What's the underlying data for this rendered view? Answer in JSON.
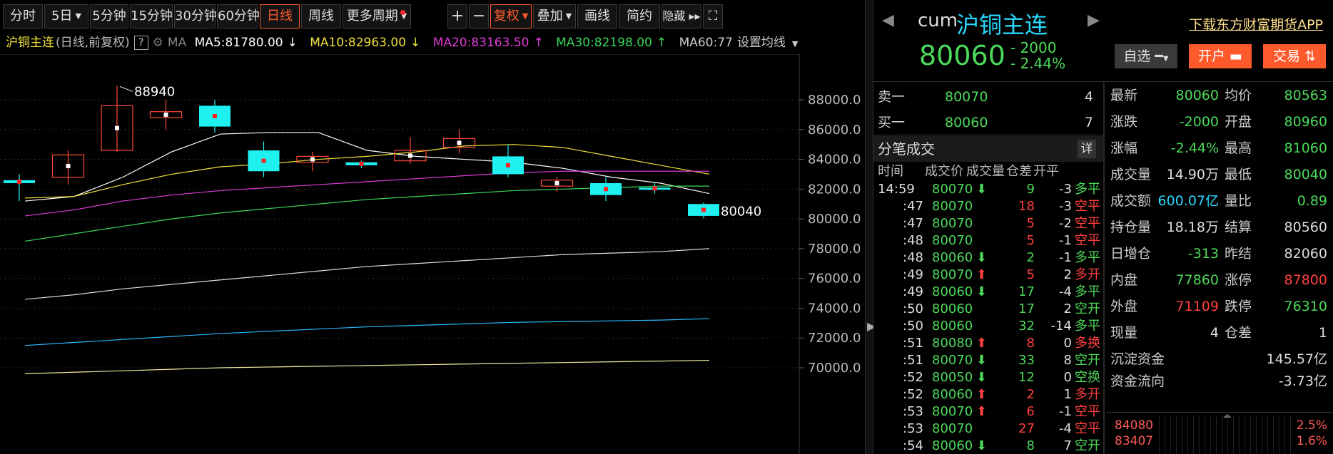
{
  "toolbar": {
    "items": [
      "分时",
      "5日",
      "5分钟",
      "15分钟",
      "30分钟",
      "60分钟",
      "日线",
      "周线",
      "更多周期"
    ],
    "plus": "+",
    "minus": "−",
    "fuquan": "复权",
    "diejia": "叠加",
    "huaxian": "画线",
    "jiancao": "简约",
    "yincang": "隐藏 ▸▸",
    "expand": "⛶"
  },
  "ma_line": {
    "symbol": "沪铜主连",
    "mode": "(日线,前复权)",
    "help": "?",
    "ma_label": "MA",
    "ma5": "MA5:81780.00",
    "ma10": "MA10:82963.00",
    "ma20": "MA20:83163.50",
    "ma30": "MA30:82198.00",
    "ma60": "MA60:77",
    "set": "设置均线",
    "arrow_down": "↓",
    "arrow_up": "↑",
    "colors": {
      "ma5": "#ffffff",
      "ma10": "#f2e03a",
      "ma20": "#e03ad8",
      "ma30": "#3ad85a",
      "ma60": "#cccccc"
    }
  },
  "chart_data": {
    "type": "candlestick",
    "yaxis_ticks": [
      "88000.0",
      "86000.0",
      "84000.0",
      "82000.0",
      "80000.0",
      "78000.0",
      "76000.0",
      "74000.0",
      "72000.0",
      "70000.0"
    ],
    "ylim": [
      69000,
      90000
    ],
    "high_label": "88940",
    "low_label": "80040",
    "candles": [
      {
        "o": 82600,
        "c": 82400,
        "h": 83000,
        "l": 81200
      },
      {
        "o": 82800,
        "c": 84300,
        "h": 84600,
        "l": 82300
      },
      {
        "o": 84600,
        "c": 87600,
        "h": 88940,
        "l": 84500
      },
      {
        "o": 86800,
        "c": 87200,
        "h": 88000,
        "l": 86000
      },
      {
        "o": 87600,
        "c": 86200,
        "h": 88000,
        "l": 85800
      },
      {
        "o": 84600,
        "c": 83200,
        "h": 85200,
        "l": 82800
      },
      {
        "o": 83800,
        "c": 84200,
        "h": 84500,
        "l": 83200
      },
      {
        "o": 83800,
        "c": 83600,
        "h": 83900,
        "l": 83400
      },
      {
        "o": 83900,
        "c": 84600,
        "h": 85500,
        "l": 83700
      },
      {
        "o": 84800,
        "c": 85400,
        "h": 86000,
        "l": 84400
      },
      {
        "o": 84200,
        "c": 83000,
        "h": 85000,
        "l": 82800
      },
      {
        "o": 82200,
        "c": 82600,
        "h": 82800,
        "l": 81800
      },
      {
        "o": 82400,
        "c": 81600,
        "h": 82800,
        "l": 81200
      },
      {
        "o": 82100,
        "c": 82000,
        "h": 82400,
        "l": 81700
      },
      {
        "o": 81000,
        "c": 80200,
        "h": 81100,
        "l": 80040
      }
    ],
    "ma_lines": {
      "ma5": [
        81200,
        81500,
        82800,
        84500,
        85700,
        85800,
        85800,
        84600,
        84200,
        84000,
        83800,
        83400,
        82800,
        82400,
        81700
      ],
      "ma10": [
        81400,
        81500,
        82300,
        83000,
        83500,
        83700,
        84000,
        84200,
        84500,
        84900,
        85000,
        84800,
        84200,
        83600,
        83000
      ],
      "ma20": [
        80200,
        80600,
        81200,
        81600,
        81900,
        82100,
        82300,
        82500,
        82700,
        82900,
        83100,
        83200,
        83200,
        83200,
        83200
      ],
      "ma30": [
        78500,
        79000,
        79500,
        80000,
        80400,
        80700,
        81000,
        81300,
        81500,
        81700,
        81900,
        82000,
        82100,
        82200,
        82200
      ],
      "ma60": [
        74600,
        74900,
        75300,
        75600,
        75900,
        76200,
        76500,
        76800,
        77000,
        77200,
        77400,
        77600,
        77700,
        77800,
        78000
      ],
      "ma120": [
        71500,
        71700,
        71900,
        72100,
        72300,
        72450,
        72600,
        72750,
        72850,
        72950,
        73050,
        73100,
        73150,
        73200,
        73300
      ],
      "ma250": [
        69600,
        69700,
        69800,
        69900,
        70000,
        70050,
        70100,
        70150,
        70200,
        70250,
        70300,
        70350,
        70400,
        70450,
        70500
      ]
    }
  },
  "header": {
    "code": "cum",
    "name": "沪铜主连",
    "price": "80060",
    "change": "- 2000",
    "change_pct": "- 2.44%",
    "download": "下载东方财富期货APP",
    "zixuan": "自选",
    "kaihu": "开户",
    "jiaoyi": "交易"
  },
  "book": [
    {
      "label": "卖一",
      "price": "80070",
      "vol": "4"
    },
    {
      "label": "买一",
      "price": "80060",
      "vol": "7"
    }
  ],
  "ticks_title": "分笔成交",
  "ticks_detail": "详",
  "ticks_cols": [
    "时间",
    "成交价",
    "成交量",
    "仓差",
    "开平"
  ],
  "ticks": [
    {
      "t": "14:59",
      "p": "80070",
      "dir": "down",
      "v": "9",
      "vc": "g",
      "oi": "-3",
      "k": "多平",
      "kc": "g"
    },
    {
      "t": ":47",
      "p": "80070",
      "dir": "",
      "v": "18",
      "vc": "r",
      "oi": "-3",
      "k": "空平",
      "kc": "r"
    },
    {
      "t": ":47",
      "p": "80070",
      "dir": "",
      "v": "5",
      "vc": "r",
      "oi": "-2",
      "k": "空平",
      "kc": "r"
    },
    {
      "t": ":48",
      "p": "80070",
      "dir": "",
      "v": "5",
      "vc": "r",
      "oi": "-1",
      "k": "空平",
      "kc": "r"
    },
    {
      "t": ":48",
      "p": "80060",
      "dir": "down",
      "v": "2",
      "vc": "g",
      "oi": "-1",
      "k": "多平",
      "kc": "g"
    },
    {
      "t": ":49",
      "p": "80070",
      "dir": "up",
      "v": "5",
      "vc": "r",
      "oi": "2",
      "k": "多开",
      "kc": "r"
    },
    {
      "t": ":49",
      "p": "80060",
      "dir": "down",
      "v": "17",
      "vc": "g",
      "oi": "-4",
      "k": "多平",
      "kc": "g"
    },
    {
      "t": ":50",
      "p": "80060",
      "dir": "",
      "v": "17",
      "vc": "g",
      "oi": "2",
      "k": "空开",
      "kc": "g"
    },
    {
      "t": ":50",
      "p": "80060",
      "dir": "",
      "v": "32",
      "vc": "g",
      "oi": "-14",
      "k": "多平",
      "kc": "g"
    },
    {
      "t": ":51",
      "p": "80080",
      "dir": "up",
      "v": "8",
      "vc": "r",
      "oi": "0",
      "k": "多换",
      "kc": "r"
    },
    {
      "t": ":51",
      "p": "80070",
      "dir": "down",
      "v": "33",
      "vc": "g",
      "oi": "8",
      "k": "空开",
      "kc": "g"
    },
    {
      "t": ":52",
      "p": "80050",
      "dir": "down",
      "v": "12",
      "vc": "g",
      "oi": "0",
      "k": "空换",
      "kc": "g"
    },
    {
      "t": ":52",
      "p": "80060",
      "dir": "up",
      "v": "2",
      "vc": "r",
      "oi": "1",
      "k": "多开",
      "kc": "r"
    },
    {
      "t": ":53",
      "p": "80070",
      "dir": "up",
      "v": "6",
      "vc": "r",
      "oi": "-1",
      "k": "空平",
      "kc": "r"
    },
    {
      "t": ":53",
      "p": "80070",
      "dir": "",
      "v": "27",
      "vc": "r",
      "oi": "-4",
      "k": "空平",
      "kc": "r"
    },
    {
      "t": ":54",
      "p": "80060",
      "dir": "down",
      "v": "8",
      "vc": "g",
      "oi": "7",
      "k": "空开",
      "kc": "g"
    }
  ],
  "stats": [
    {
      "k1": "最新",
      "v1": "80060",
      "c1": "g",
      "k2": "均价",
      "v2": "80563",
      "c2": "g"
    },
    {
      "k1": "涨跌",
      "v1": "-2000",
      "c1": "g",
      "k2": "开盘",
      "v2": "80960",
      "c2": "g"
    },
    {
      "k1": "涨幅",
      "v1": "-2.44%",
      "c1": "g",
      "k2": "最高",
      "v2": "81060",
      "c2": "g"
    },
    {
      "k1": "成交量",
      "v1": "14.90万",
      "c1": "w",
      "k2": "最低",
      "v2": "80040",
      "c2": "g"
    },
    {
      "k1": "成交额",
      "v1": "600.07亿",
      "c1": "c",
      "k2": "量比",
      "v2": "0.89",
      "c2": "g"
    },
    {
      "k1": "持仓量",
      "v1": "18.18万",
      "c1": "w",
      "k2": "结算",
      "v2": "80560",
      "c2": "w"
    },
    {
      "k1": "日增仓",
      "v1": "-313",
      "c1": "g",
      "k2": "昨结",
      "v2": "82060",
      "c2": "w"
    },
    {
      "k1": "内盘",
      "v1": "77860",
      "c1": "g",
      "k2": "涨停",
      "v2": "87800",
      "c2": "r"
    },
    {
      "k1": "外盘",
      "v1": "71109",
      "c1": "r",
      "k2": "跌停",
      "v2": "76310",
      "c2": "g"
    },
    {
      "k1": "现量",
      "v1": "4",
      "c1": "w",
      "k2": "仓差",
      "v2": "1",
      "c2": "w"
    }
  ],
  "wide_stats": [
    {
      "k": "沉淀资金",
      "v": "145.57亿"
    },
    {
      "k": "资金流向",
      "v": "-3.73亿"
    }
  ],
  "depth": [
    {
      "l": "84080",
      "r": "2.5%"
    },
    {
      "l": "83407",
      "r": "1.6%"
    }
  ],
  "colors": {
    "up": "#ff4040",
    "down": "#4cd95a",
    "cyan": "#29d8ff",
    "accent": "#ff5a2c"
  }
}
